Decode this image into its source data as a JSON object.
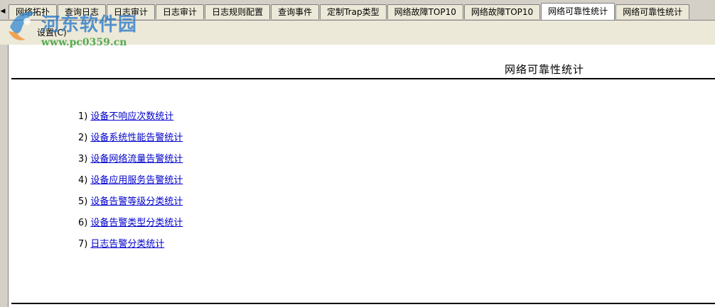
{
  "tabs": [
    {
      "label": "网络拓扑"
    },
    {
      "label": "查询日志"
    },
    {
      "label": "日志审计"
    },
    {
      "label": "日志审计"
    },
    {
      "label": "日志规则配置"
    },
    {
      "label": "查询事件"
    },
    {
      "label": "定制Trap类型"
    },
    {
      "label": "网络故障TOP10"
    },
    {
      "label": "网络故障TOP10"
    },
    {
      "label": "网络可靠性统计",
      "active": true
    },
    {
      "label": "网络可靠性统计"
    }
  ],
  "menu": {
    "settings_label": "设置(C)"
  },
  "watermark": {
    "name": "河东软件园",
    "url": "www.pc0359.cn"
  },
  "report": {
    "title": "网络可靠性统计",
    "items": [
      {
        "number": "1)",
        "label": "设备不响应次数统计"
      },
      {
        "number": "2)",
        "label": "设备系统性能告警统计"
      },
      {
        "number": "3)",
        "label": "设备网络流量告警统计"
      },
      {
        "number": "4)",
        "label": "设备应用服务告警统计"
      },
      {
        "number": "5)",
        "label": "设备告警等级分类统计"
      },
      {
        "number": "6)",
        "label": "设备告警类型分类统计"
      },
      {
        "number": "7)",
        "label": "日志告警分类统计"
      }
    ]
  },
  "colors": {
    "link": "#0000cc",
    "tab_bg": "#ece9d8",
    "window_bg": "#d4d0c8"
  }
}
